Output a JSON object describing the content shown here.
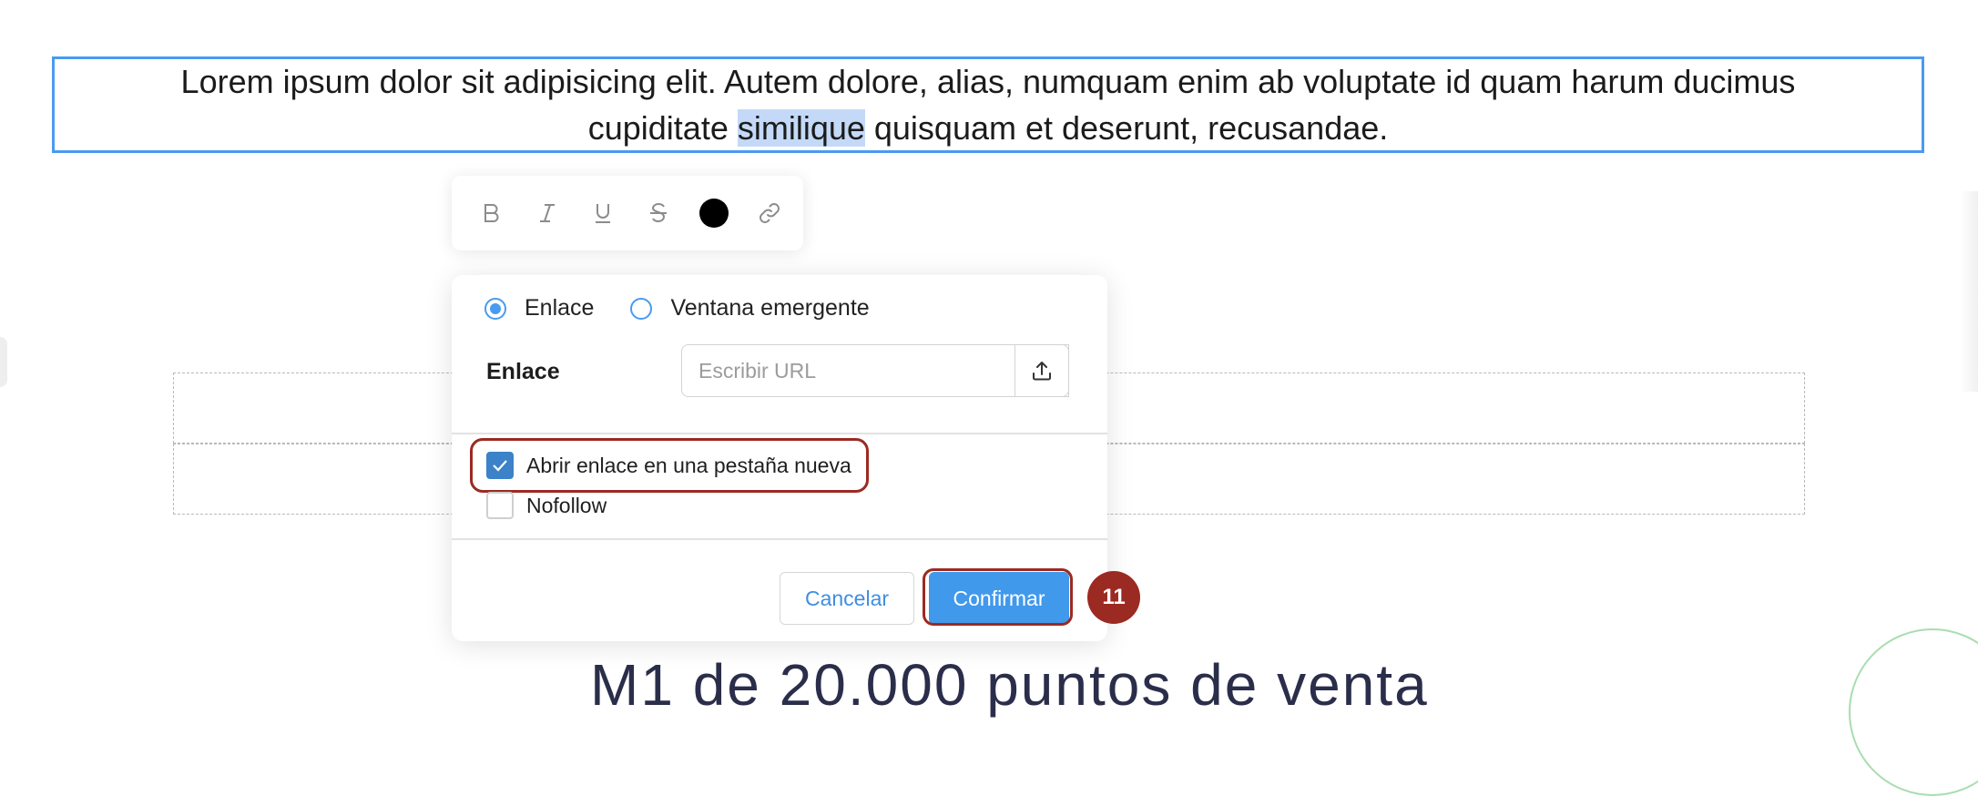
{
  "paragraph": {
    "before": "Lorem ipsum dolor sit adipisicing elit. Autem dolore, alias, numquam enim ab voluptate id quam harum ducimus cupiditate ",
    "selected": "similique",
    "after": " quisquam et deserunt, recusandae."
  },
  "toolbar": {
    "bold": "B",
    "italic": "I",
    "underline": "U",
    "strike": "S",
    "text_color": "#000000"
  },
  "dialog": {
    "type_options": [
      {
        "label": "Enlace",
        "selected": true
      },
      {
        "label": "Ventana emergente",
        "selected": false
      }
    ],
    "link_label": "Enlace",
    "url_placeholder": "Escribir URL",
    "url_value": "",
    "open_new_tab": {
      "label": "Abrir enlace en una pestaña nueva",
      "checked": true
    },
    "nofollow": {
      "label": "Nofollow",
      "checked": false
    },
    "cancel_label": "Cancelar",
    "confirm_label": "Confirmar"
  },
  "step_badge": "11",
  "bottom_heading": "M1 de 20.000 puntos de venta"
}
